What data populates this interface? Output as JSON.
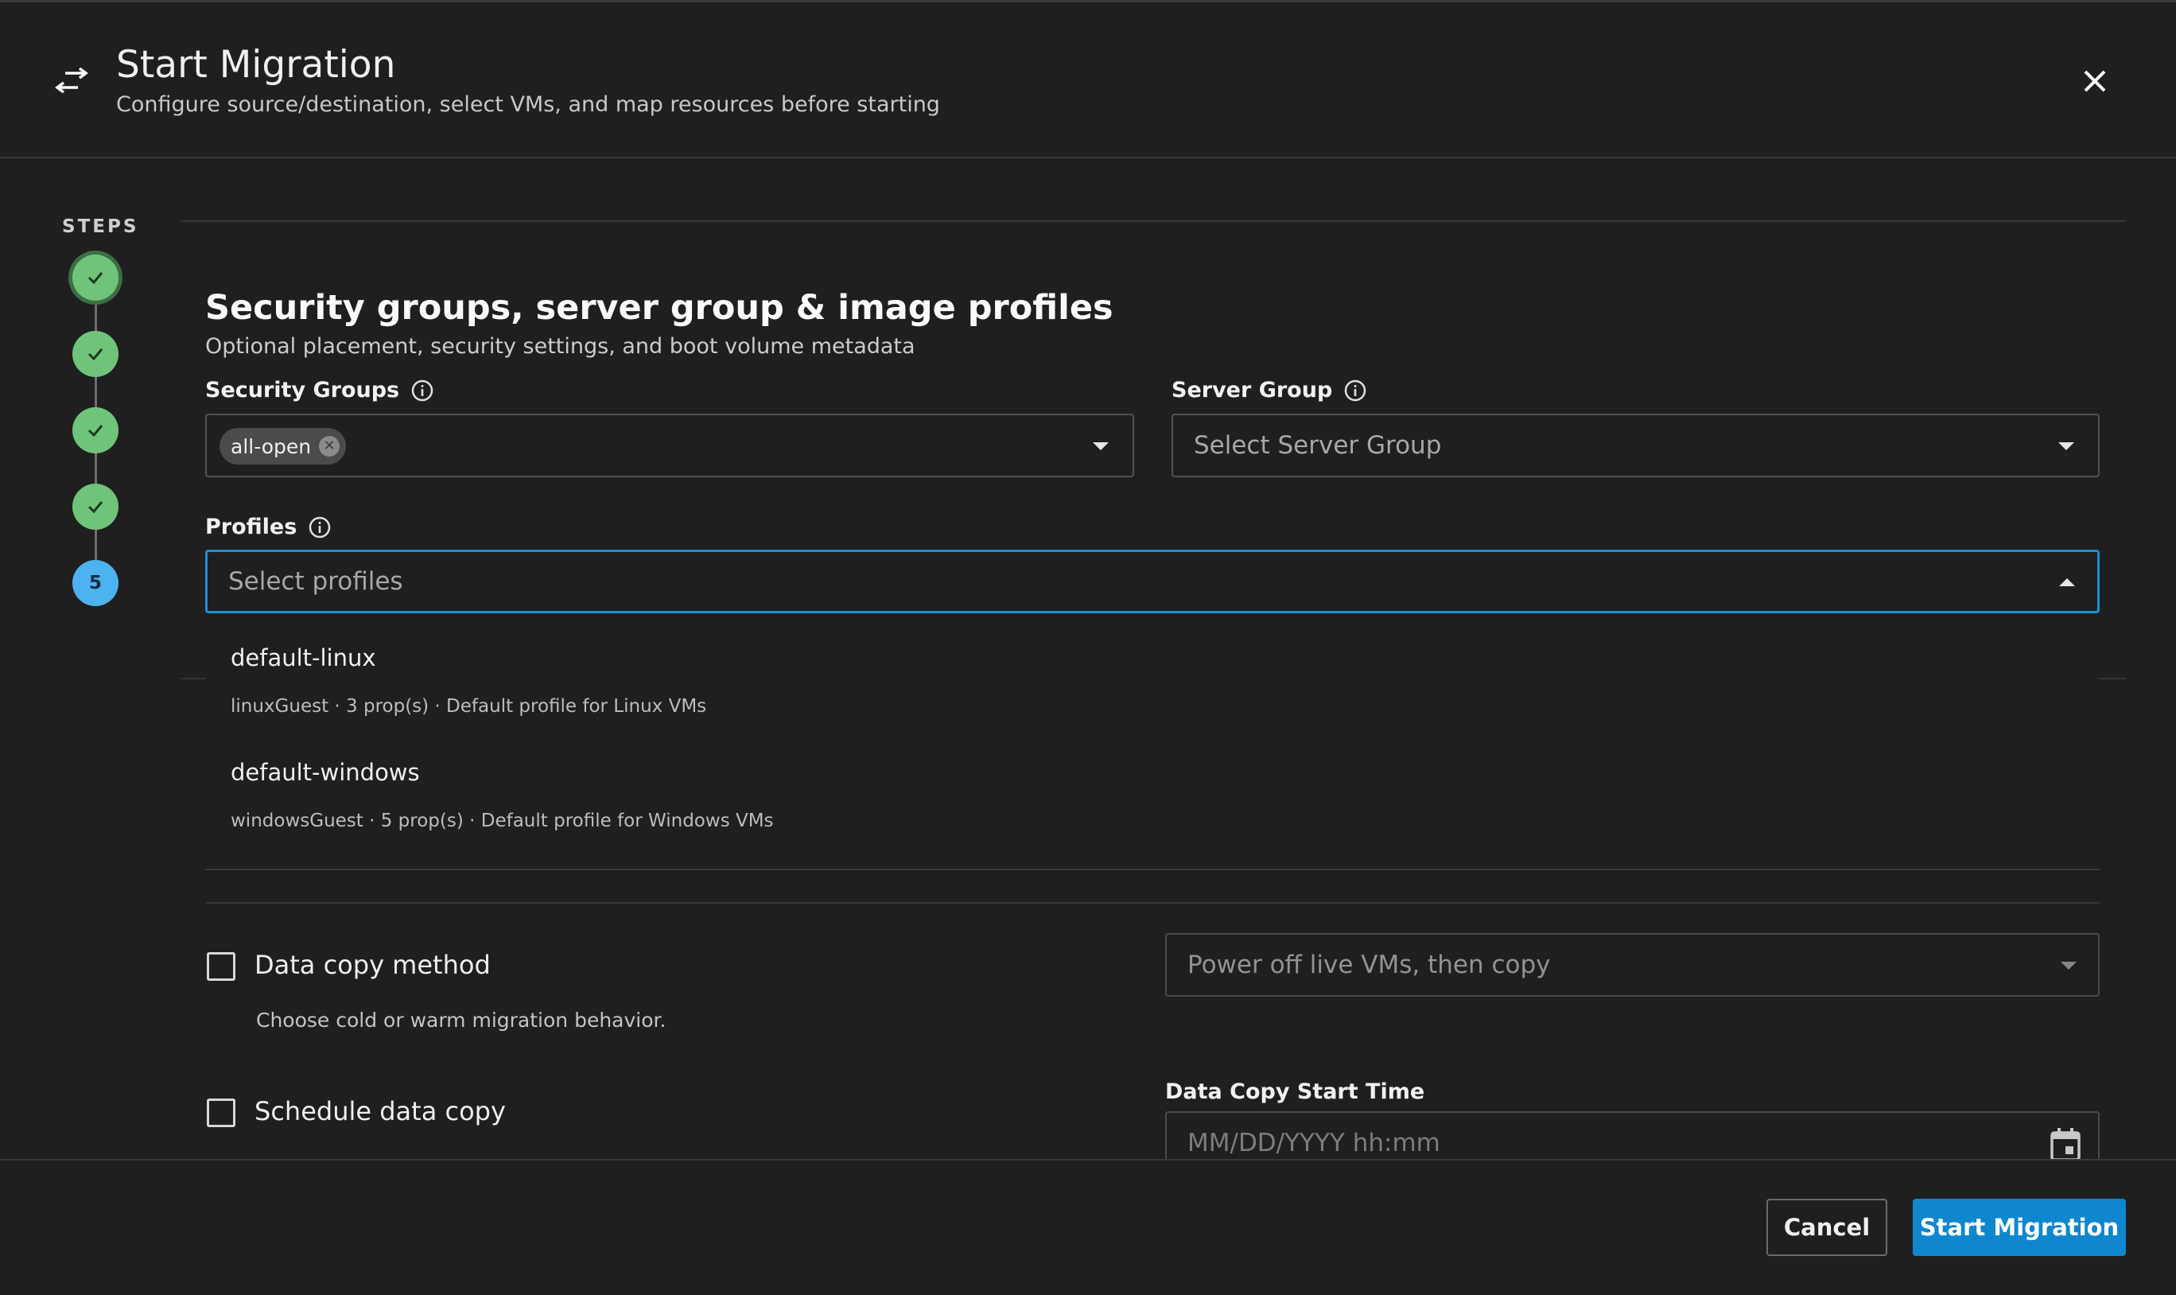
{
  "header": {
    "icon": "arrows-swap-icon",
    "title": "Start Migration",
    "subtitle": "Configure source/destination, select VMs, and map resources before starting",
    "close_icon": "close-icon"
  },
  "steps": {
    "label": "STEPS",
    "items": [
      {
        "status": "complete",
        "icon": "check-icon"
      },
      {
        "status": "complete",
        "icon": "check-icon"
      },
      {
        "status": "complete",
        "icon": "check-icon"
      },
      {
        "status": "complete",
        "icon": "check-icon"
      },
      {
        "status": "current",
        "number": "5"
      }
    ],
    "colors": {
      "complete": "#6fc47a",
      "current": "#4db3f0"
    }
  },
  "section": {
    "title": "Security groups, server group & image profiles",
    "subtitle": "Optional placement, security settings, and boot volume metadata"
  },
  "security_groups": {
    "label": "Security Groups",
    "selected": [
      {
        "label": "all-open"
      }
    ]
  },
  "server_group": {
    "label": "Server Group",
    "placeholder": "Select Server Group"
  },
  "profiles": {
    "label": "Profiles",
    "placeholder": "Select profiles",
    "accent": "#1a8fd6",
    "options": [
      {
        "name": "default-linux",
        "description": "linuxGuest · 3 prop(s) · Default profile for Linux VMs"
      },
      {
        "name": "default-windows",
        "description": "windowsGuest · 5 prop(s) · Default profile for Windows VMs"
      }
    ]
  },
  "data_copy_method": {
    "label": "Data copy method",
    "helper": "Choose cold or warm migration behavior.",
    "select_value": "Power off live VMs, then copy"
  },
  "schedule": {
    "label": "Schedule data copy",
    "time_label": "Data Copy Start Time",
    "time_placeholder": "MM/DD/YYYY hh:mm",
    "calendar_icon": "calendar-icon"
  },
  "footer": {
    "cancel_label": "Cancel",
    "start_label": "Start Migration",
    "primary_color": "#0f87cf"
  }
}
